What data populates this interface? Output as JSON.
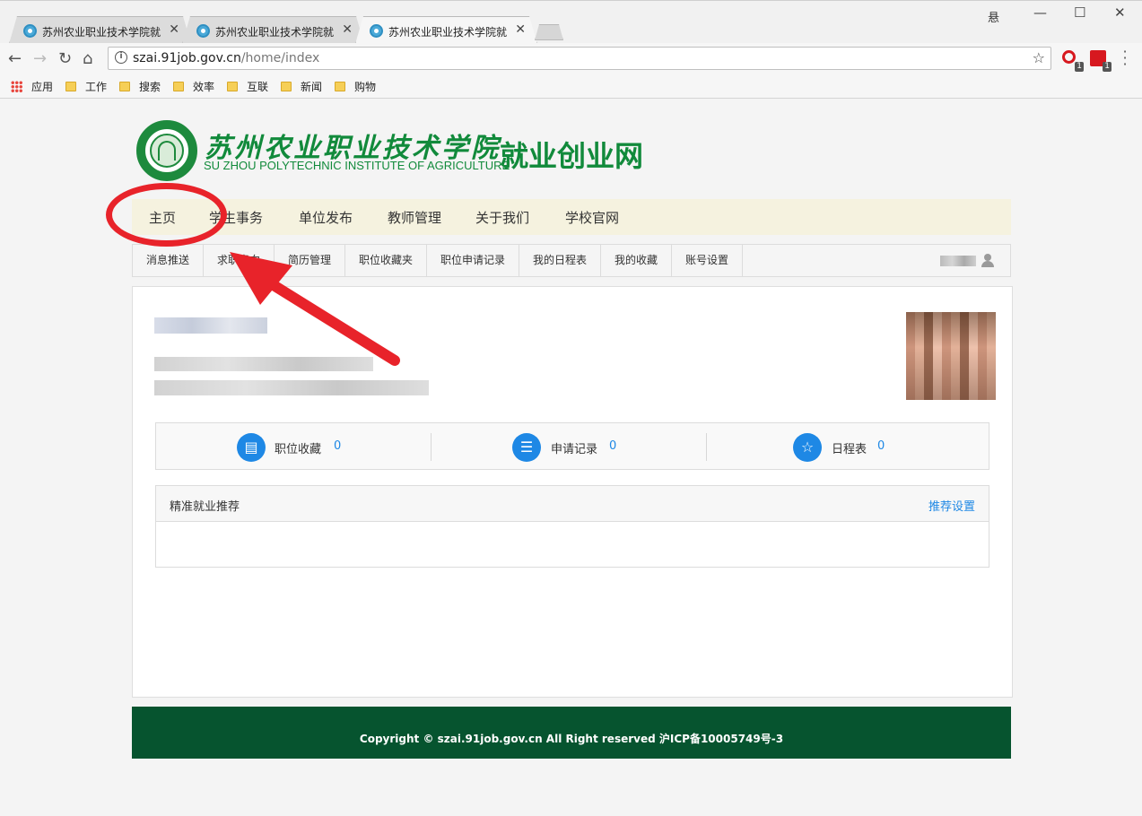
{
  "browser": {
    "tabs": [
      {
        "title": "苏州农业职业技术学院就",
        "active": false
      },
      {
        "title": "苏州农业职业技术学院就",
        "active": false
      },
      {
        "title": "苏州农业职业技术学院就",
        "active": true
      }
    ],
    "tab_close": "✕",
    "window_user": "悬",
    "url_host": "szai.91job.gov.cn",
    "url_path": "/home/index",
    "ext_badge_1": "1",
    "ext_badge_2": "1",
    "bookmarks": [
      "应用",
      "工作",
      "搜索",
      "效率",
      "互联",
      "新闻",
      "购物"
    ]
  },
  "site": {
    "logo_cn": "苏州农业职业技术学院",
    "logo_en": "SU ZHOU POLYTECHNIC INSTITUTE OF AGRICULTURE",
    "logo_site": "就业创业网",
    "main_nav": [
      "主页",
      "学生事务",
      "单位发布",
      "教师管理",
      "关于我们",
      "学校官网"
    ],
    "sub_nav": [
      "消息推送",
      "求职意向",
      "简历管理",
      "职位收藏夹",
      "职位申请记录",
      "我的日程表",
      "我的收藏",
      "账号设置"
    ]
  },
  "profile": {
    "stats": [
      {
        "label": "职位收藏",
        "count": "0",
        "icon": "document-star-icon"
      },
      {
        "label": "申请记录",
        "count": "0",
        "icon": "list-document-icon"
      },
      {
        "label": "日程表",
        "count": "0",
        "icon": "star-icon"
      }
    ],
    "reco_title": "精准就业推荐",
    "reco_setting": "推荐设置"
  },
  "footer": {
    "text": "Copyright © szai.91job.gov.cn All Right reserved 沪ICP备10005749号-3"
  },
  "colors": {
    "brand_green": "#118a3b",
    "footer_green": "#06542f",
    "link_blue": "#1e88e5",
    "annotation_red": "#e8232a"
  }
}
